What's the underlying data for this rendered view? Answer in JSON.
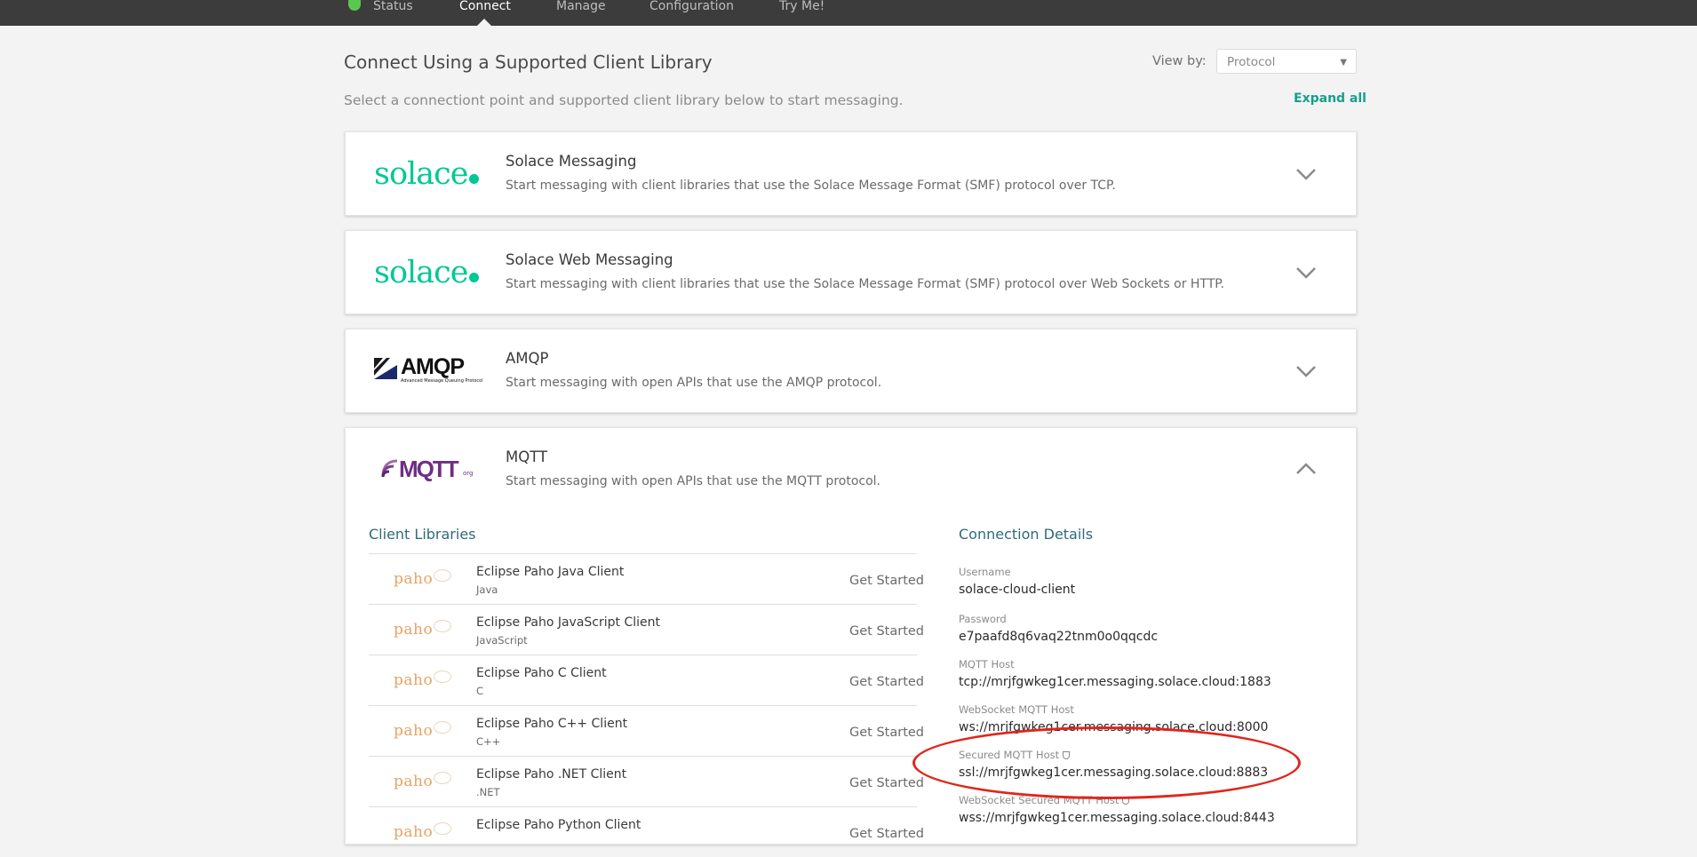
{
  "nav": {
    "items": [
      "Status",
      "Connect",
      "Manage",
      "Configuration",
      "Try Me!"
    ],
    "active": "Connect",
    "status_color": "#5cc650"
  },
  "header": {
    "title": "Connect Using a Supported Client Library",
    "subtitle": "Select a connectiont point and supported client library below to start messaging.",
    "view_by_label": "View by:",
    "view_by_value": "Protocol",
    "expand_all": "Expand all"
  },
  "protocols": [
    {
      "logo": "solace",
      "title": "Solace Messaging",
      "description": "Start messaging with client libraries that use the Solace Message Format (SMF) protocol over TCP.",
      "expanded": false
    },
    {
      "logo": "solace",
      "title": "Solace Web Messaging",
      "description": "Start messaging with client libraries that use the Solace Message Format (SMF) protocol over Web Sockets or HTTP.",
      "expanded": false
    },
    {
      "logo": "AMQP",
      "logo_subtitle": "Advanced Message Queuing Protocol",
      "title": "AMQP",
      "description": "Start messaging with open APIs that use the AMQP protocol.",
      "expanded": false
    },
    {
      "logo": "MQTT",
      "title": "MQTT",
      "description": "Start messaging with open APIs that use the MQTT protocol.",
      "expanded": true
    }
  ],
  "logos": {
    "solace": "solace",
    "amqp": "AMQP",
    "mqtt": "MQTT",
    "mqtt_suffix": "org",
    "paho": "paho"
  },
  "mqtt": {
    "client_libraries_title": "Client Libraries",
    "libraries": [
      {
        "name": "Eclipse Paho Java Client",
        "language": "Java",
        "action": "Get Started"
      },
      {
        "name": "Eclipse Paho JavaScript Client",
        "language": "JavaScript",
        "action": "Get Started"
      },
      {
        "name": "Eclipse Paho C Client",
        "language": "C",
        "action": "Get Started"
      },
      {
        "name": "Eclipse Paho C++ Client",
        "language": "C++",
        "action": "Get Started"
      },
      {
        "name": "Eclipse Paho .NET Client",
        "language": ".NET",
        "action": "Get Started"
      },
      {
        "name": "Eclipse Paho Python Client",
        "language": "",
        "action": "Get Started"
      }
    ],
    "connection_details_title": "Connection Details",
    "details": [
      {
        "label": "Username",
        "value": "solace-cloud-client",
        "secure": false
      },
      {
        "label": "Password",
        "value": "e7paafd8q6vaq22tnm0o0qqcdc",
        "secure": false
      },
      {
        "label": "MQTT Host",
        "value": "tcp://mrjfgwkeg1cer.messaging.solace.cloud:1883",
        "secure": false
      },
      {
        "label": "WebSocket MQTT Host",
        "value": "ws://mrjfgwkeg1cer.messaging.solace.cloud:8000",
        "secure": false
      },
      {
        "label": "Secured MQTT Host",
        "value": "ssl://mrjfgwkeg1cer.messaging.solace.cloud:8883",
        "secure": true
      },
      {
        "label": "WebSocket Secured MQTT Host",
        "value": "wss://mrjfgwkeg1cer.messaging.solace.cloud:8443",
        "secure": true
      }
    ]
  },
  "annotation": {
    "color": "#e0261c",
    "target": "Secured MQTT Host"
  }
}
